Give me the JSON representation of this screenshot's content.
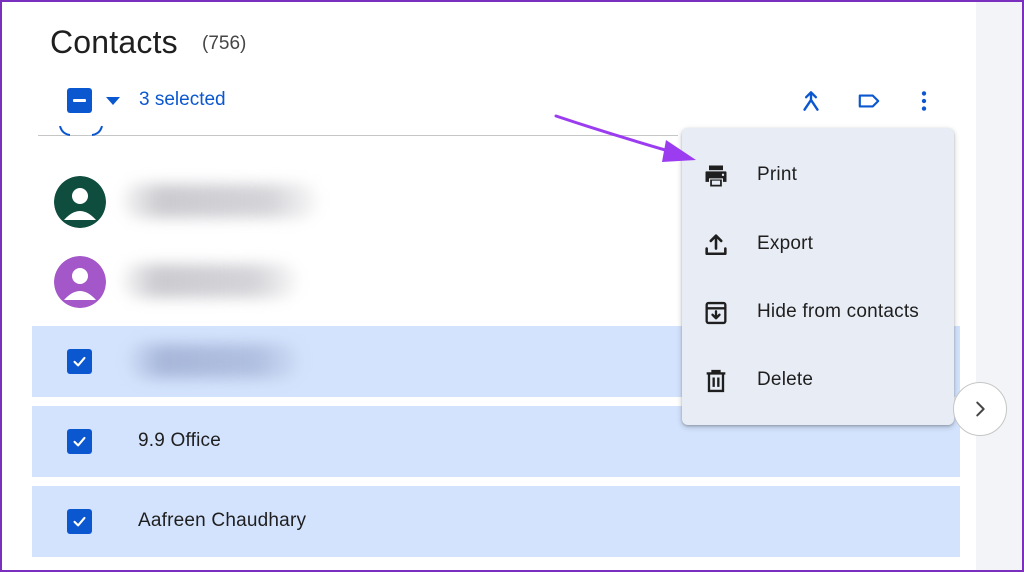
{
  "header": {
    "title": "Contacts",
    "count": "(756)"
  },
  "toolbar": {
    "selected_label": "3 selected",
    "icons": [
      "merge-icon",
      "label-icon",
      "more-vert-icon"
    ]
  },
  "contacts": [
    {
      "name": "",
      "avatar_color": "#0f4d3f",
      "selected": false
    },
    {
      "name": "",
      "avatar_color": "#a457c8",
      "selected": false
    },
    {
      "name": "",
      "selected": true
    },
    {
      "name": "9.9 Office",
      "selected": true
    },
    {
      "name": "Aafreen Chaudhary",
      "selected": true
    }
  ],
  "menu": {
    "items": [
      {
        "label": "Print",
        "icon": "print-icon"
      },
      {
        "label": "Export",
        "icon": "export-icon"
      },
      {
        "label": "Hide from contacts",
        "icon": "hide-archive-icon"
      },
      {
        "label": "Delete",
        "icon": "trash-icon"
      }
    ]
  },
  "colors": {
    "accent": "#0b57d0",
    "selected_row": "#d3e3fd",
    "menu_bg": "#e8ecf5",
    "annotation_arrow": "#9b3cf0"
  }
}
